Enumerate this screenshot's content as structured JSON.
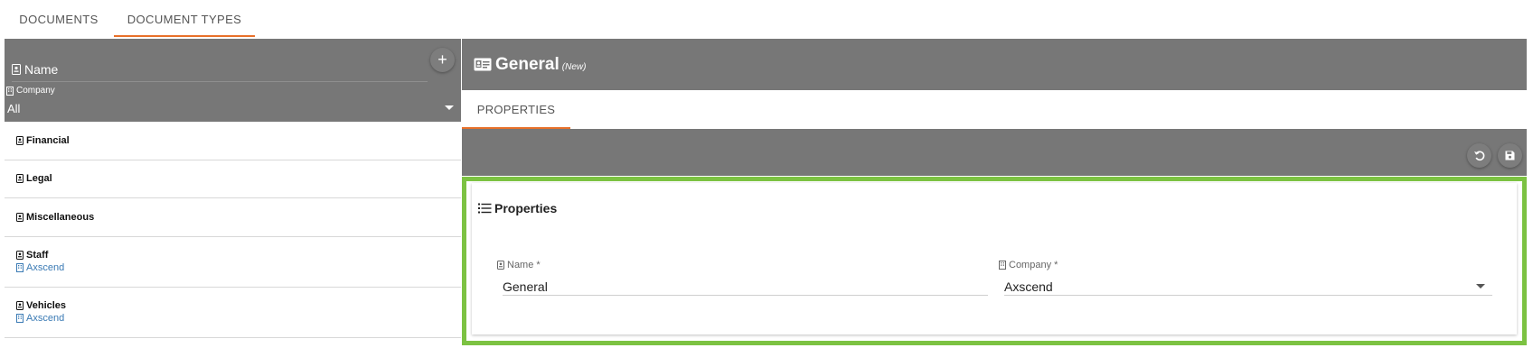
{
  "tabs": [
    {
      "label": "DOCUMENTS",
      "active": false
    },
    {
      "label": "DOCUMENT TYPES",
      "active": true
    }
  ],
  "filter": {
    "name_label": "Name",
    "company_label": "Company",
    "company_value": "All",
    "add_icon": "plus-icon"
  },
  "document_types": [
    {
      "name": "Financial",
      "company": ""
    },
    {
      "name": "Legal",
      "company": ""
    },
    {
      "name": "Miscellaneous",
      "company": ""
    },
    {
      "name": "Staff",
      "company": "Axscend"
    },
    {
      "name": "Vehicles",
      "company": "Axscend"
    }
  ],
  "detail": {
    "title": "General",
    "badge": "(New)",
    "tab_label": "PROPERTIES",
    "section_title": "Properties",
    "name_field": {
      "label": "Name *",
      "value": "General"
    },
    "company_field": {
      "label": "Company *",
      "value": "Axscend"
    }
  },
  "colors": {
    "accent": "#e8702a",
    "header_bg": "#777777",
    "highlight": "#7cc242",
    "link": "#3a7ab4"
  }
}
